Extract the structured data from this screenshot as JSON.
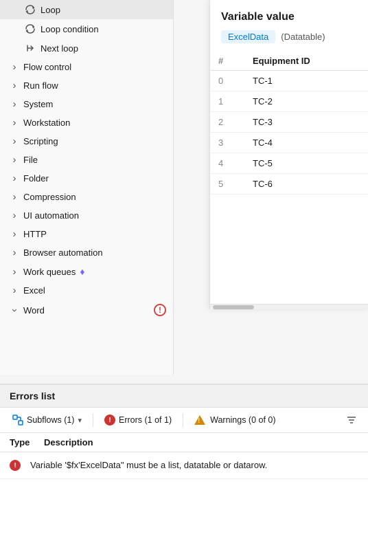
{
  "sidebar": {
    "items": [
      {
        "id": "loop",
        "label": "Loop",
        "type": "sub",
        "icon": "loop"
      },
      {
        "id": "loop-condition",
        "label": "Loop condition",
        "type": "sub",
        "icon": "loop-condition"
      },
      {
        "id": "next-loop",
        "label": "Next loop",
        "type": "sub",
        "icon": "next-loop"
      },
      {
        "id": "flow-control",
        "label": "Flow control",
        "type": "group",
        "expanded": false
      },
      {
        "id": "run-flow",
        "label": "Run flow",
        "type": "group",
        "expanded": false
      },
      {
        "id": "system",
        "label": "System",
        "type": "group",
        "expanded": false
      },
      {
        "id": "workstation",
        "label": "Workstation",
        "type": "group",
        "expanded": false
      },
      {
        "id": "scripting",
        "label": "Scripting",
        "type": "group",
        "expanded": false
      },
      {
        "id": "file",
        "label": "File",
        "type": "group",
        "expanded": false
      },
      {
        "id": "folder",
        "label": "Folder",
        "type": "group",
        "expanded": false
      },
      {
        "id": "compression",
        "label": "Compression",
        "type": "group",
        "expanded": false
      },
      {
        "id": "ui-automation",
        "label": "UI automation",
        "type": "group",
        "expanded": false
      },
      {
        "id": "http",
        "label": "HTTP",
        "type": "group",
        "expanded": false
      },
      {
        "id": "browser-automation",
        "label": "Browser automation",
        "type": "group",
        "expanded": false
      },
      {
        "id": "work-queues",
        "label": "Work queues",
        "type": "group",
        "expanded": false,
        "badge": "diamond"
      },
      {
        "id": "excel",
        "label": "Excel",
        "type": "group",
        "expanded": false
      },
      {
        "id": "word",
        "label": "Word",
        "type": "group",
        "expanded": true,
        "warning": true
      }
    ]
  },
  "variable_panel": {
    "title": "Variable value",
    "tag": "ExcelData",
    "type_label": "(Datatable)",
    "columns": [
      "#",
      "Equipment ID"
    ],
    "rows": [
      {
        "index": "0",
        "value": "TC-1"
      },
      {
        "index": "1",
        "value": "TC-2"
      },
      {
        "index": "2",
        "value": "TC-3"
      },
      {
        "index": "3",
        "value": "TC-4"
      },
      {
        "index": "4",
        "value": "TC-5"
      },
      {
        "index": "5",
        "value": "TC-6"
      }
    ]
  },
  "errors_section": {
    "title": "Errors list",
    "toolbar": {
      "subflows_label": "Subflows (1)",
      "errors_label": "Errors (1 of 1)",
      "warnings_label": "Warnings (0 of 0)"
    },
    "table": {
      "col_type": "Type",
      "col_desc": "Description"
    },
    "errors": [
      {
        "type": "error",
        "description": "Variable '$fx'ExcelData\" must be a list, datatable or datarow."
      }
    ]
  }
}
